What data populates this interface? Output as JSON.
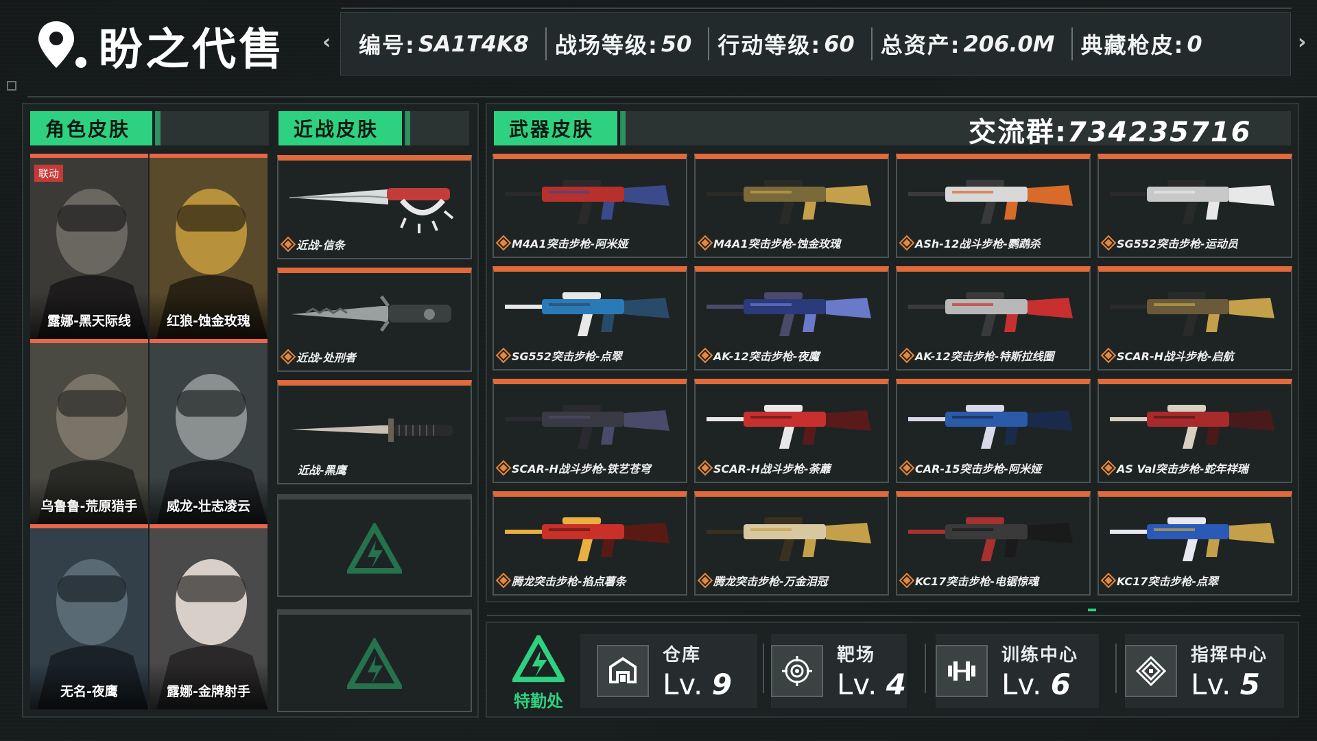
{
  "brand": {
    "name": "盼之代售"
  },
  "stats": [
    {
      "key": "编号:",
      "value": "SA1T4K8"
    },
    {
      "key": "战场等级:",
      "value": "50"
    },
    {
      "key": "行动等级:",
      "value": "60"
    },
    {
      "key": "总资产:",
      "value": "206.0M"
    },
    {
      "key": "典藏枪皮:",
      "value": "0"
    }
  ],
  "tabs": {
    "character": "角色皮肤",
    "melee": "近战皮肤",
    "weapon": "武器皮肤"
  },
  "group": {
    "label": "交流群:",
    "number": "734235716"
  },
  "characters": [
    {
      "name": "露娜-黑天际线",
      "badge": "联动"
    },
    {
      "name": "红狼-蚀金玫瑰"
    },
    {
      "name": "乌鲁鲁-荒原猎手"
    },
    {
      "name": "威龙-壮志凌云"
    },
    {
      "name": "无名-夜鹰"
    },
    {
      "name": "露娜-金牌射手"
    }
  ],
  "melee": [
    {
      "name": "近战-信条"
    },
    {
      "name": "近战-处刑者"
    },
    {
      "name": "近战-黑鹰"
    }
  ],
  "weapons": [
    {
      "name": "M4A1突击步枪-阿米娅"
    },
    {
      "name": "M4A1突击步枪-蚀金玫瑰"
    },
    {
      "name": "ASh-12战斗步枪-鹦鹉杀"
    },
    {
      "name": "SG552突击步枪-运动员"
    },
    {
      "name": "SG552突击步枪-点翠"
    },
    {
      "name": "AK-12突击步枪-夜魔"
    },
    {
      "name": "AK-12突击步枪-特斯拉线圈"
    },
    {
      "name": "SCAR-H战斗步枪-启航"
    },
    {
      "name": "SCAR-H战斗步枪-铁艺苍穹"
    },
    {
      "name": "SCAR-H战斗步枪-荼蘼"
    },
    {
      "name": "CAR-15突击步枪-阿米娅"
    },
    {
      "name": "AS Val突击步枪-蛇年祥瑞"
    },
    {
      "name": "腾龙突击步枪-掐点薯条"
    },
    {
      "name": "腾龙突击步枪-万金泪冠"
    },
    {
      "name": "KC17突击步枪-电锯惊魂"
    },
    {
      "name": "KC17突击步枪-点翠"
    }
  ],
  "footer": {
    "logo_label": "特勤处",
    "facilities": [
      {
        "name": "仓库",
        "level_prefix": "Lv.",
        "level": "9",
        "icon": "warehouse-icon"
      },
      {
        "name": "靶场",
        "level_prefix": "Lv.",
        "level": "4",
        "icon": "target-icon"
      },
      {
        "name": "训练中心",
        "level_prefix": "Lv.",
        "level": "6",
        "icon": "dumbbell-icon"
      },
      {
        "name": "指挥中心",
        "level_prefix": "Lv.",
        "level": "5",
        "icon": "command-icon"
      }
    ]
  },
  "colors": {
    "accent_green": "#2ed17f",
    "card_orange": "#e06a3c",
    "badge_red": "#c43a38",
    "background": "#15191a"
  }
}
